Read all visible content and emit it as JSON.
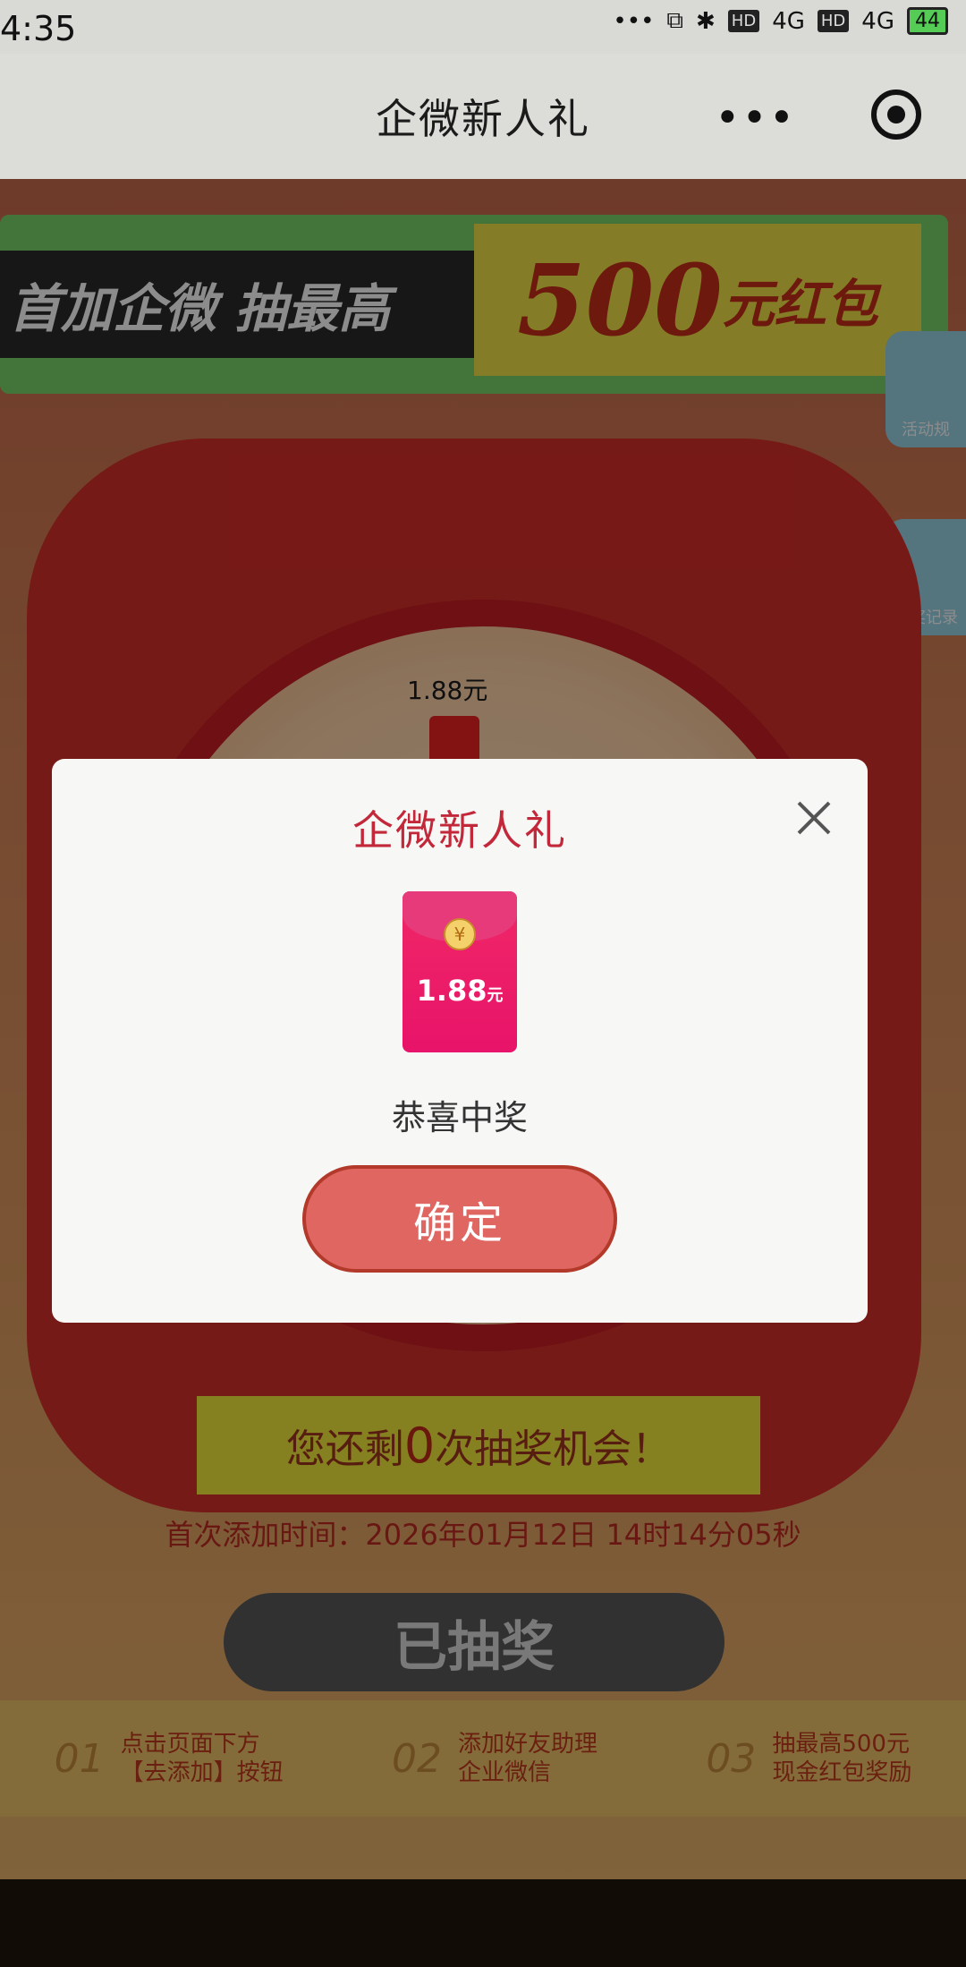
{
  "status_bar": {
    "time": "4:35",
    "icons": [
      "more-dots",
      "cast-icon",
      "bluetooth-icon",
      "hd-badge",
      "signal-4g",
      "hd-badge",
      "signal-4g",
      "battery-icon"
    ],
    "hd1": "HD",
    "net1": "4G",
    "hd2": "HD",
    "net2": "4G",
    "battery": "44"
  },
  "title_bar": {
    "title": "企微新人礼",
    "more": "•••"
  },
  "page": {
    "banner_left": "首加企微 抽最高",
    "banner_big": "500",
    "banner_small": "元红包",
    "side_btn_1": "活动规",
    "side_btn_2": "中奖记录",
    "wheel_prize_label": "1.88元",
    "remain_prefix": "您还剩",
    "remain_count": "0",
    "remain_suffix": "次抽奖机会！",
    "first_time_label": "首次添加时间：2026年01月12日 14时14分05秒",
    "drawn_button": "已抽奖",
    "steps": [
      {
        "num": "01",
        "line1": "点击页面下方",
        "line2": "【去添加】按钮"
      },
      {
        "num": "02",
        "line1": "添加好友助理",
        "line2": "企业微信"
      },
      {
        "num": "03",
        "line1": "抽最高500元",
        "line2": "现金红包奖励"
      }
    ]
  },
  "modal": {
    "title": "企微新人礼",
    "envelope_amount": "1.88",
    "envelope_unit": "元",
    "envelope_coin": "¥",
    "congrats": "恭喜中奖",
    "confirm": "确定"
  },
  "colors": {
    "modal_title": "#c3283a",
    "confirm_bg": "#e06662",
    "envelope": "#e8136a"
  }
}
